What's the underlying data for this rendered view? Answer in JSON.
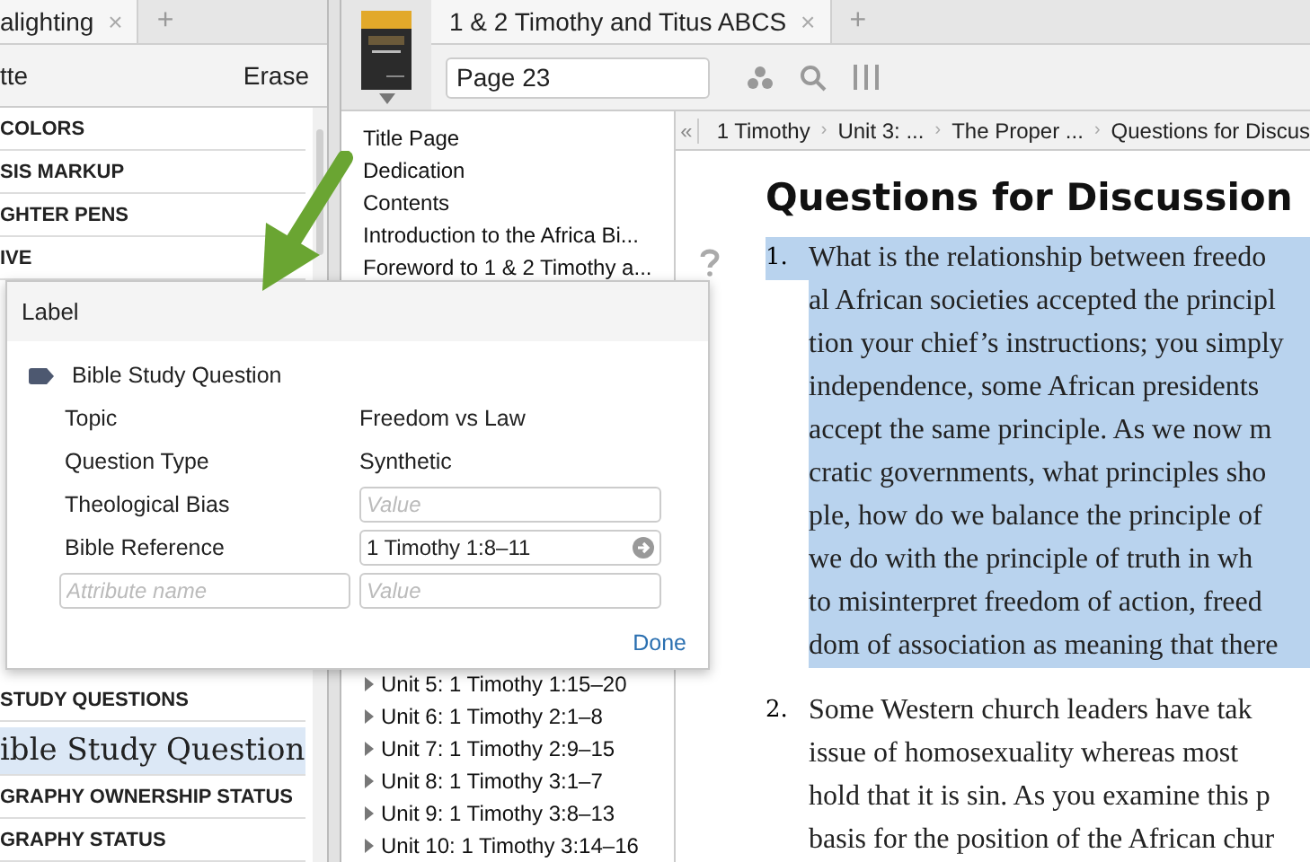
{
  "highlighting_panel": {
    "tab": {
      "label": "alighting",
      "close": "×"
    },
    "new_tab": "+",
    "header": {
      "title": "tte",
      "erase": "Erase"
    },
    "items_top": [
      {
        "label": "COLORS",
        "kind": "heading",
        "selected": false
      },
      {
        "label": "SIS MARKUP",
        "kind": "heading",
        "selected": false
      },
      {
        "label": "GHTER PENS",
        "kind": "heading",
        "selected": false
      },
      {
        "label": "IVE",
        "kind": "heading",
        "selected": false
      }
    ],
    "items_bottom": [
      {
        "label": "STUDY QUESTIONS",
        "kind": "heading",
        "selected": false
      },
      {
        "label": "ible Study Question",
        "kind": "style",
        "selected": true
      },
      {
        "label": "GRAPHY OWNERSHIP STATUS",
        "kind": "heading",
        "selected": false
      },
      {
        "label": "GRAPHY STATUS",
        "kind": "heading",
        "selected": false
      }
    ]
  },
  "book_panel": {
    "tab": {
      "label": "1 & 2 Timothy and Titus ABCS",
      "close": "×"
    },
    "new_tab": "+",
    "page_field": {
      "value": "Page 23"
    },
    "toc_top": [
      {
        "label": "Title Page",
        "expandable": false
      },
      {
        "label": "Dedication",
        "expandable": false
      },
      {
        "label": "Contents",
        "expandable": false
      },
      {
        "label": "Introduction to the Africa Bi...",
        "expandable": false
      },
      {
        "label": "Foreword to 1 & 2 Timothy a...",
        "expandable": false
      }
    ],
    "toc_bottom": [
      {
        "label": "Unit 5: 1 Timothy 1:15–20",
        "expandable": true
      },
      {
        "label": "Unit 6: 1 Timothy 2:1–8",
        "expandable": true
      },
      {
        "label": "Unit 7: 1 Timothy 2:9–15",
        "expandable": true
      },
      {
        "label": "Unit 8: 1 Timothy 3:1–7",
        "expandable": true
      },
      {
        "label": "Unit 9: 1 Timothy 3:8–13",
        "expandable": true
      },
      {
        "label": "Unit 10: 1 Timothy 3:14–16",
        "expandable": true
      }
    ]
  },
  "reader": {
    "breadcrumb": {
      "back": "«",
      "separator": "›",
      "items": [
        "1 Timothy",
        "Unit 3: ...",
        "The Proper ...",
        "Questions for Discus"
      ]
    },
    "heading": "Questions for Discussion",
    "questions": [
      {
        "number": "1.",
        "selected": true,
        "lines": [
          "What is the relationship between freedo",
          "al African societies accepted the principl",
          "tion your chief’s instructions; you simply",
          "independence, some African presidents",
          "accept the same principle. As we now m",
          "cratic governments, what principles sho",
          "ple, how do we balance the principle of",
          "we do with the principle of truth in wh",
          "to misinterpret freedom of action, freed",
          "dom of association as meaning that there"
        ]
      },
      {
        "number": "2.",
        "selected": false,
        "lines": [
          "Some Western church leaders have tak",
          "issue of homosexuality whereas most",
          "hold that it is sin. As you examine this p",
          "basis for the position of the African chur"
        ]
      }
    ]
  },
  "label_dialog": {
    "title": "Label",
    "label_name": "Bible Study Question",
    "attributes": [
      {
        "name": "Topic",
        "kind": "text",
        "value": "Freedom vs Law"
      },
      {
        "name": "Question Type",
        "kind": "text",
        "value": "Synthetic"
      },
      {
        "name": "Theological Bias",
        "kind": "field",
        "placeholder": "Value"
      },
      {
        "name": "Bible Reference",
        "kind": "field",
        "value": "1 Timothy 1:8–11",
        "submit": true
      }
    ],
    "new_attribute": {
      "name_placeholder": "Attribute name",
      "value_placeholder": "Value"
    },
    "done": "Done"
  }
}
